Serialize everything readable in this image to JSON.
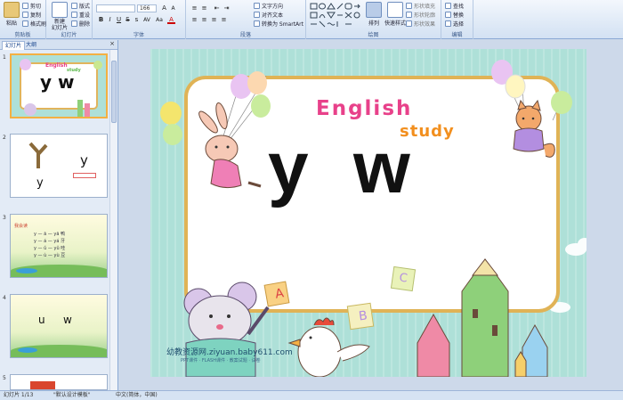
{
  "ribbon": {
    "clipboard": {
      "paste": "粘贴",
      "cut": "剪切",
      "copy": "复制",
      "format_painter": "格式刷",
      "label": "剪贴板"
    },
    "slides": {
      "new_slide": "新建\n幻灯片",
      "layout": "版式",
      "reset": "重设",
      "delete": "删除",
      "label": "幻灯片"
    },
    "font": {
      "font_name": "",
      "font_size": "166",
      "bold": "B",
      "italic": "I",
      "underline": "U",
      "strike": "S",
      "shadow": "s",
      "spacing": "AV",
      "case": "Aa",
      "color": "A",
      "label": "字体"
    },
    "paragraph": {
      "text_direction": "文字方向",
      "align_text": "对齐文本",
      "smartart": "转换为 SmartArt",
      "label": "段落"
    },
    "drawing": {
      "arrange": "排列",
      "quick_styles": "快速样式",
      "fill": "形状填充",
      "outline": "形状轮廓",
      "effects": "形状效果",
      "label": "绘图"
    },
    "editing": {
      "find": "查找",
      "replace": "替换",
      "select": "选择",
      "label": "编辑"
    }
  },
  "pane": {
    "tab_slides": "幻灯片",
    "tab_outline": "大纲",
    "close": "×",
    "thumbs": [
      {
        "num": "1",
        "text": "y  w",
        "title1": "English",
        "title2": "study"
      },
      {
        "num": "2",
        "text1": "y",
        "text2": "y"
      },
      {
        "num": "3",
        "heading": "我会读",
        "lines": [
          "y — ā — yā   鸭",
          "y — á — yá   牙",
          "y — ǔ — yǔ   哇",
          "y — ù — yù   豆"
        ]
      },
      {
        "num": "4",
        "text1": "u",
        "text2": "w"
      },
      {
        "num": "5"
      }
    ]
  },
  "slide": {
    "title1": "English",
    "title2": "study",
    "letter1": "y",
    "letter2": "w",
    "block_a": "A",
    "block_b": "B",
    "block_c": "C",
    "watermark": "幼教资源网.ziyuan.baby611.com",
    "watermark_sub": "PPT课件 · FLASH课件 · 教案试题 · 试卷"
  },
  "status": {
    "slide_info": "幻灯片 1/13",
    "theme": "\"默认设计模板\"",
    "language": "中文(简体，中国)"
  },
  "colors": {
    "slide_bg": "#aee0d8",
    "english_pink": "#e8418a",
    "study_orange": "#f28f1e",
    "selected_border": "#f4b042"
  }
}
